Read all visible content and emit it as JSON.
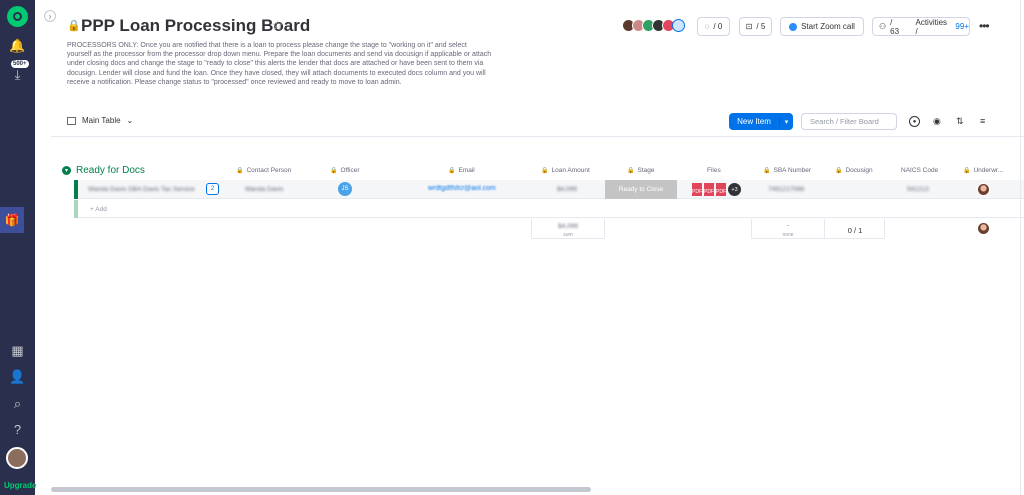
{
  "nav": {
    "inbox_badge": "500+",
    "upgrade_label": "Upgrade",
    "help_label": "?"
  },
  "board": {
    "title": "PPP Loan Processing Board",
    "description": "PROCESSORS ONLY: Once you are notified that there is a loan to process please change the stage to \"working on it\" and select yourself as the processor from the processor drop down menu. Prepare the loan documents and send via docusign if applicable or attach under closing docs and change the stage to \"ready to close\" this alerts the lender that docs are attached or have been sent to them via docusign. Lender will close and fund the loan. Once they have closed, they will attach documents to executed docs column and you will receive a notification. Please change status to \"processed\" once reviewed and ready to move to loan admin."
  },
  "header": {
    "activity_count": "/ 0",
    "integrations_count": "/ 5",
    "zoom_label": "Start Zoom call",
    "members_count": "/ 63",
    "activities_label": "Activities /",
    "activities_count": "99+"
  },
  "toolbar": {
    "view_label": "Main Table",
    "new_item_label": "New Item",
    "search_placeholder": "Search / Filter Board"
  },
  "group": {
    "title": "Ready for Docs",
    "columns": {
      "contact_person": "Contact Person",
      "officer": "Officer",
      "email": "Email",
      "loan_amount": "Loan Amount",
      "stage": "Stage",
      "files": "Files",
      "sba_number": "SBA Number",
      "docusign": "Docusign",
      "naics_code": "NAICS Code",
      "underwriter": "Underwr..."
    },
    "row": {
      "name": "Wanda Davis DBA Davis Tax Service",
      "chat_count": "2",
      "contact_person": "Wanda Davis",
      "officer_initials": "JS",
      "email": "wrdtgdtfsfcr@aol.com",
      "loan_amount": "$4,099",
      "stage": "Ready to Close",
      "files_more": "+3",
      "sba_number": "7491217088",
      "naics_code": "541213"
    },
    "add_label": "+ Add",
    "summary": {
      "loan_amount": "$4,099",
      "loan_amount_sub": "sum",
      "sba_number": "-",
      "sba_number_sub": "none",
      "docusign": "0 / 1"
    }
  },
  "colors": {
    "rail": "#292f4c",
    "group": "#037f4c",
    "primary": "#0073ea",
    "stage": "#c4c4c4",
    "pdf": "#e2445c"
  }
}
